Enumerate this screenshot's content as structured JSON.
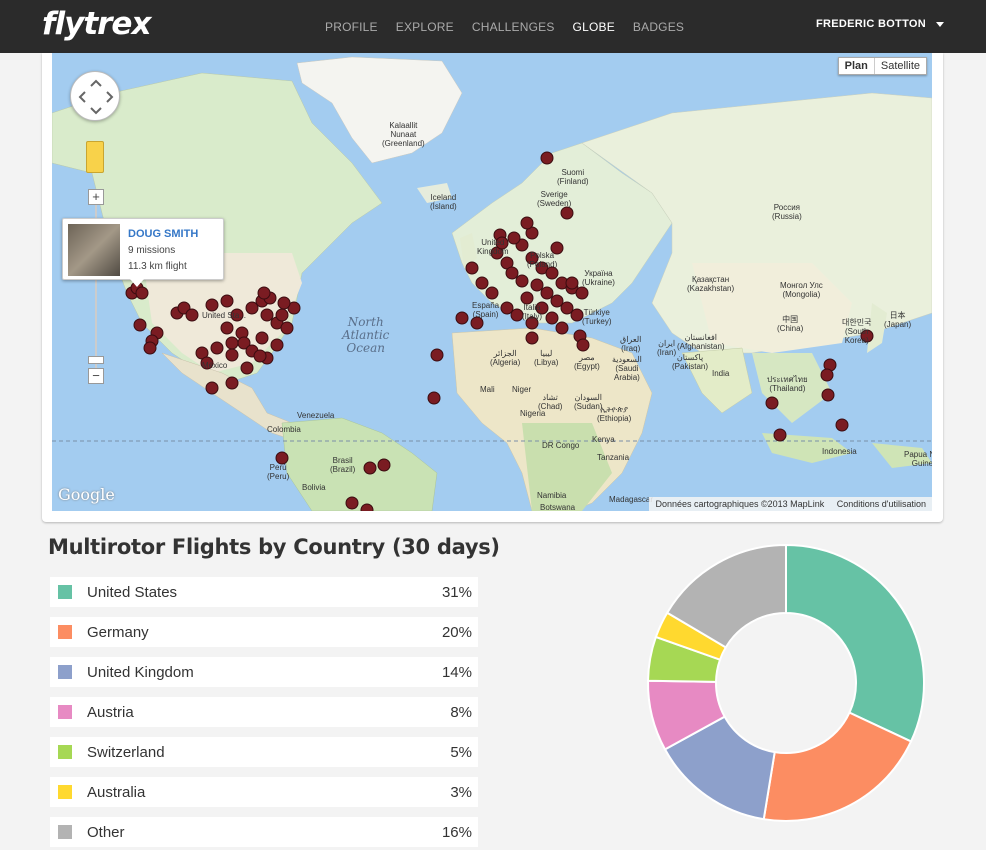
{
  "header": {
    "logo": "flytrex",
    "nav": [
      {
        "label": "PROFILE",
        "active": false
      },
      {
        "label": "EXPLORE",
        "active": false
      },
      {
        "label": "CHALLENGES",
        "active": false
      },
      {
        "label": "GLOBE",
        "active": true
      },
      {
        "label": "BADGES",
        "active": false
      }
    ],
    "user_name": "FREDERIC BOTTON"
  },
  "map": {
    "map_types": {
      "plan": "Plan",
      "satellite": "Satellite"
    },
    "popup": {
      "name": "DOUG SMITH",
      "missions": "9 missions",
      "flight": "11.3 km flight"
    },
    "google_logo": "Google",
    "attribution": "Données cartographiques ©2013 MapLink",
    "terms": "Conditions d'utilisation",
    "ocean_labels": [
      "North\nAtlantic\nOcean"
    ],
    "country_labels": [
      "Kalaallit\nNunaat\n(Greenland)",
      "Iceland\n(Ísland)",
      "Suomi\n(Finland)",
      "Sverige\n(Sweden)",
      "Россия\n(Russia)",
      "United\nKingdom",
      "Polska\n(Poland)",
      "Україна\n(Ukraine)",
      "Қазақстан\n(Kazakhstan)",
      "Монгол Улс\n(Mongolia)",
      "España\n(Spain)",
      "Italia\n(Italy)",
      "Türkiye\n(Turkey)",
      "中国\n(China)",
      "日本\n(Japan)",
      "대한민국\n(South\nKorea)",
      "العراق\n(Iraq)",
      "ایران\n(Iran)",
      "افغانستان\n(Afghanistan)",
      "پاکستان\n(Pakistan)",
      "India",
      "ประเทศไทย\n(Thailand)",
      "الجزائر\n(Algeria)",
      "ليبيا\n(Libya)",
      "مصر\n(Egypt)",
      "السعودية\n(Saudi\nArabia)",
      "Mali",
      "Niger",
      "تشاد\n(Chad)",
      "السودان\n(Sudan)",
      "ኢትዮጵያ\n(Ethiopia)",
      "Nigeria",
      "DR Congo",
      "Kenya",
      "Tanzania",
      "Namibia",
      "Botswana",
      "Madagascar",
      "Indonesia",
      "Papua New\nGuinea",
      "México",
      "United Sta...",
      "Venezuela",
      "Colombia",
      "Perú\n(Peru)",
      "Brasil\n(Brazil)",
      "Bolivia"
    ],
    "marker_color": "#7a1c22"
  },
  "stats": {
    "title": "Multirotor Flights by Country (30 days)",
    "legend": [
      {
        "country": "United States",
        "pct": "31%",
        "color": "#66c2a5"
      },
      {
        "country": "Germany",
        "pct": "20%",
        "color": "#fc8d62"
      },
      {
        "country": "United Kingdom",
        "pct": "14%",
        "color": "#8da0cb"
      },
      {
        "country": "Austria",
        "pct": "8%",
        "color": "#e78ac3"
      },
      {
        "country": "Switzerland",
        "pct": "5%",
        "color": "#a6d854"
      },
      {
        "country": "Australia",
        "pct": "3%",
        "color": "#ffd92f"
      },
      {
        "country": "Other",
        "pct": "16%",
        "color": "#b3b3b3"
      }
    ]
  },
  "chart_data": {
    "type": "pie",
    "categories": [
      "United States",
      "Germany",
      "United Kingdom",
      "Austria",
      "Switzerland",
      "Australia",
      "Other"
    ],
    "values": [
      31,
      20,
      14,
      8,
      5,
      3,
      16
    ],
    "colors": [
      "#66c2a5",
      "#fc8d62",
      "#8da0cb",
      "#e78ac3",
      "#a6d854",
      "#ffd92f",
      "#b3b3b3"
    ],
    "donut": true
  }
}
